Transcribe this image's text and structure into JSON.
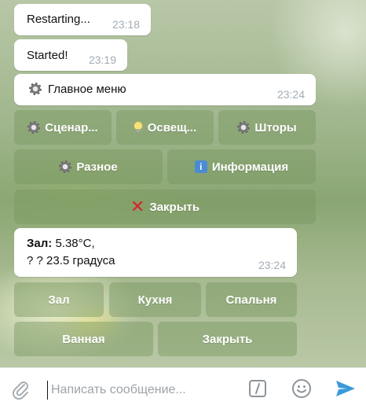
{
  "messages": [
    {
      "text": "Restarting...",
      "time": "23:18"
    },
    {
      "text": "Started!",
      "time": "23:19"
    },
    {
      "text": "Главное меню",
      "time": "23:24",
      "icon": "gear-icon"
    }
  ],
  "menu_keyboard": {
    "scenarios": "Сценар...",
    "lighting": "Освещ...",
    "blinds": "Шторы",
    "misc": "Разное",
    "info": "Информация",
    "close": "Закрыть"
  },
  "status_message": {
    "room": "Зал",
    "sep": ":",
    "temperature": " 5.38°C,",
    "line2": "? ? 23.5 градуса",
    "time": "23:24"
  },
  "rooms_keyboard": {
    "hall": "Зал",
    "kitchen": "Кухня",
    "bedroom": "Спальня",
    "bathroom": "Ванная",
    "close": "Закрыть"
  },
  "composer": {
    "placeholder": "Написать сообщение...",
    "icons": [
      "paperclip-icon",
      "bot-command-icon",
      "emoji-icon",
      "send-icon"
    ]
  },
  "colors": {
    "accent": "#3a9ad9",
    "close_icon": "#d9232a"
  }
}
